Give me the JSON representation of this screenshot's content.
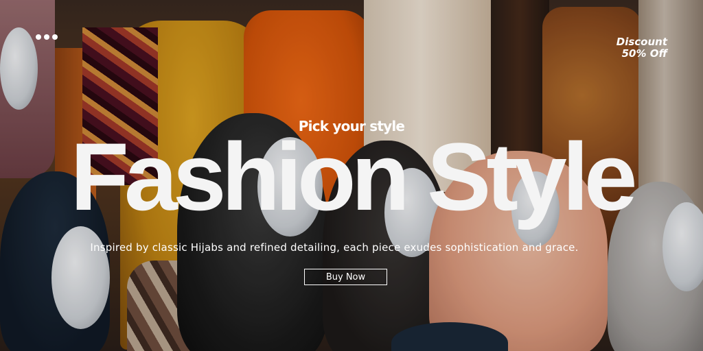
{
  "banner": {
    "subtitle": "Pick your style",
    "headline": "Fashion Style",
    "description": "Inspired by classic Hijabs and refined detailing, each piece exudes sophistication and grace.",
    "cta_label": "Buy Now"
  },
  "discount": {
    "line1": "Discount",
    "line2": "50% Off"
  },
  "menu": {
    "icon": "more-dots-icon"
  },
  "colors": {
    "text": "#ffffff",
    "accent_orange": "#e0601a",
    "accent_mustard": "#d09a20"
  }
}
